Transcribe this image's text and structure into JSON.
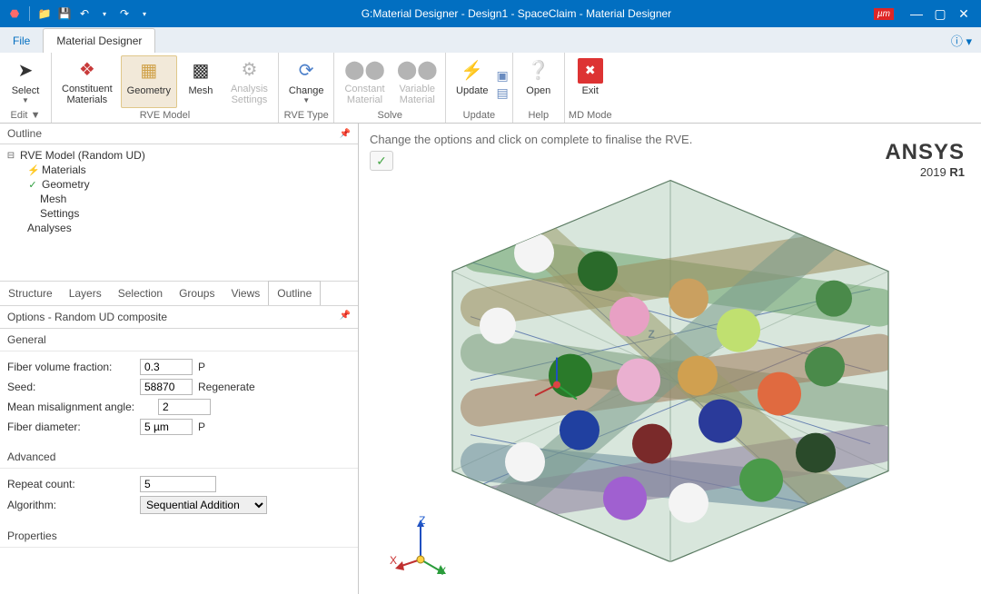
{
  "titlebar": {
    "title": "G:Material Designer - Design1 - SpaceClaim - Material Designer",
    "unit_badge": "µm"
  },
  "menubar": {
    "file": "File",
    "tab_active": "Material Designer"
  },
  "ribbon": {
    "edit": {
      "select": "Select",
      "edit": "Edit",
      "label": "Edit"
    },
    "rve": {
      "constituent": "Constituent\nMaterials",
      "geometry": "Geometry",
      "mesh": "Mesh",
      "analysis": "Analysis\nSettings",
      "label": "RVE Model"
    },
    "rvetype": {
      "change": "Change",
      "label": "RVE Type"
    },
    "solve": {
      "constant": "Constant\nMaterial",
      "variable": "Variable\nMaterial",
      "label": "Solve"
    },
    "update": {
      "update": "Update",
      "label": "Update"
    },
    "help": {
      "open": "Open",
      "label": "Help"
    },
    "mdmode": {
      "exit": "Exit",
      "label": "MD Mode"
    }
  },
  "outline": {
    "header": "Outline",
    "root": "RVE Model (Random UD)",
    "items": [
      "Materials",
      "Geometry",
      "Mesh",
      "Settings"
    ],
    "analyses": "Analyses"
  },
  "bottomtabs": [
    "Structure",
    "Layers",
    "Selection",
    "Groups",
    "Views",
    "Outline"
  ],
  "options": {
    "header": "Options - Random UD composite",
    "general_header": "General",
    "fields": {
      "fvf_label": "Fiber volume fraction:",
      "fvf_value": "0.3",
      "fvf_suffix": "P",
      "seed_label": "Seed:",
      "seed_value": "58870",
      "seed_suffix": "Regenerate",
      "mma_label": "Mean misalignment angle:",
      "mma_value": "2",
      "fd_label": "Fiber diameter:",
      "fd_value": "5 µm",
      "fd_suffix": "P"
    },
    "advanced_header": "Advanced",
    "adv": {
      "repeat_label": "Repeat count:",
      "repeat_value": "5",
      "algo_label": "Algorithm:",
      "algo_value": "Sequential Addition"
    },
    "properties_header": "Properties"
  },
  "viewport": {
    "hint": "Change the options and click on complete to finalise the RVE.",
    "brand1": "ANSYS",
    "brand2_a": "2019 ",
    "brand2_b": "R1",
    "axes": {
      "x": "X",
      "y": "Y",
      "z": "Z"
    }
  }
}
